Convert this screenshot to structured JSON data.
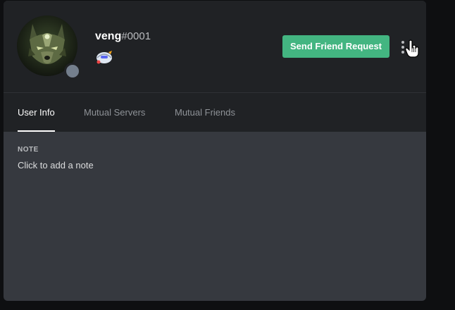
{
  "profile": {
    "username": "veng",
    "discriminator": "#0001",
    "status": "offline",
    "avatar_icon": "wolf-avatar",
    "badge_icon": "hypesquad-badge"
  },
  "actions": {
    "send_friend_request_label": "Send Friend Request",
    "more_icon": "more-vertical-icon"
  },
  "tabs": [
    {
      "label": "User Info",
      "active": true
    },
    {
      "label": "Mutual Servers",
      "active": false
    },
    {
      "label": "Mutual Friends",
      "active": false
    }
  ],
  "note": {
    "title": "NOTE",
    "placeholder": "Click to add a note"
  },
  "colors": {
    "accent_green": "#43b581",
    "header_bg": "#202225",
    "body_bg": "#36393f",
    "status_offline": "#747f8d"
  }
}
